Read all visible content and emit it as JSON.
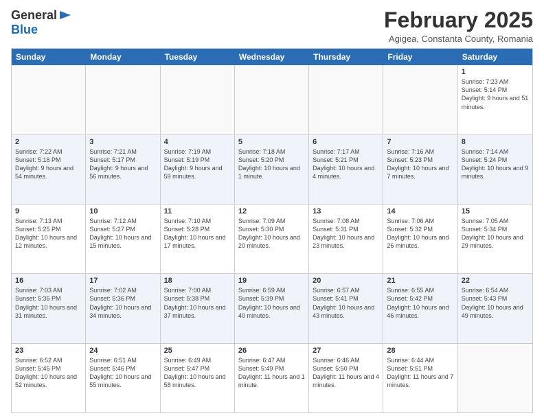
{
  "logo": {
    "general": "General",
    "blue": "Blue"
  },
  "title": "February 2025",
  "location": "Agigea, Constanta County, Romania",
  "days_of_week": [
    "Sunday",
    "Monday",
    "Tuesday",
    "Wednesday",
    "Thursday",
    "Friday",
    "Saturday"
  ],
  "weeks": [
    [
      {
        "day": "",
        "info": ""
      },
      {
        "day": "",
        "info": ""
      },
      {
        "day": "",
        "info": ""
      },
      {
        "day": "",
        "info": ""
      },
      {
        "day": "",
        "info": ""
      },
      {
        "day": "",
        "info": ""
      },
      {
        "day": "1",
        "info": "Sunrise: 7:23 AM\nSunset: 5:14 PM\nDaylight: 9 hours and 51 minutes."
      }
    ],
    [
      {
        "day": "2",
        "info": "Sunrise: 7:22 AM\nSunset: 5:16 PM\nDaylight: 9 hours and 54 minutes."
      },
      {
        "day": "3",
        "info": "Sunrise: 7:21 AM\nSunset: 5:17 PM\nDaylight: 9 hours and 56 minutes."
      },
      {
        "day": "4",
        "info": "Sunrise: 7:19 AM\nSunset: 5:19 PM\nDaylight: 9 hours and 59 minutes."
      },
      {
        "day": "5",
        "info": "Sunrise: 7:18 AM\nSunset: 5:20 PM\nDaylight: 10 hours and 1 minute."
      },
      {
        "day": "6",
        "info": "Sunrise: 7:17 AM\nSunset: 5:21 PM\nDaylight: 10 hours and 4 minutes."
      },
      {
        "day": "7",
        "info": "Sunrise: 7:16 AM\nSunset: 5:23 PM\nDaylight: 10 hours and 7 minutes."
      },
      {
        "day": "8",
        "info": "Sunrise: 7:14 AM\nSunset: 5:24 PM\nDaylight: 10 hours and 9 minutes."
      }
    ],
    [
      {
        "day": "9",
        "info": "Sunrise: 7:13 AM\nSunset: 5:25 PM\nDaylight: 10 hours and 12 minutes."
      },
      {
        "day": "10",
        "info": "Sunrise: 7:12 AM\nSunset: 5:27 PM\nDaylight: 10 hours and 15 minutes."
      },
      {
        "day": "11",
        "info": "Sunrise: 7:10 AM\nSunset: 5:28 PM\nDaylight: 10 hours and 17 minutes."
      },
      {
        "day": "12",
        "info": "Sunrise: 7:09 AM\nSunset: 5:30 PM\nDaylight: 10 hours and 20 minutes."
      },
      {
        "day": "13",
        "info": "Sunrise: 7:08 AM\nSunset: 5:31 PM\nDaylight: 10 hours and 23 minutes."
      },
      {
        "day": "14",
        "info": "Sunrise: 7:06 AM\nSunset: 5:32 PM\nDaylight: 10 hours and 26 minutes."
      },
      {
        "day": "15",
        "info": "Sunrise: 7:05 AM\nSunset: 5:34 PM\nDaylight: 10 hours and 29 minutes."
      }
    ],
    [
      {
        "day": "16",
        "info": "Sunrise: 7:03 AM\nSunset: 5:35 PM\nDaylight: 10 hours and 31 minutes."
      },
      {
        "day": "17",
        "info": "Sunrise: 7:02 AM\nSunset: 5:36 PM\nDaylight: 10 hours and 34 minutes."
      },
      {
        "day": "18",
        "info": "Sunrise: 7:00 AM\nSunset: 5:38 PM\nDaylight: 10 hours and 37 minutes."
      },
      {
        "day": "19",
        "info": "Sunrise: 6:59 AM\nSunset: 5:39 PM\nDaylight: 10 hours and 40 minutes."
      },
      {
        "day": "20",
        "info": "Sunrise: 6:57 AM\nSunset: 5:41 PM\nDaylight: 10 hours and 43 minutes."
      },
      {
        "day": "21",
        "info": "Sunrise: 6:55 AM\nSunset: 5:42 PM\nDaylight: 10 hours and 46 minutes."
      },
      {
        "day": "22",
        "info": "Sunrise: 6:54 AM\nSunset: 5:43 PM\nDaylight: 10 hours and 49 minutes."
      }
    ],
    [
      {
        "day": "23",
        "info": "Sunrise: 6:52 AM\nSunset: 5:45 PM\nDaylight: 10 hours and 52 minutes."
      },
      {
        "day": "24",
        "info": "Sunrise: 6:51 AM\nSunset: 5:46 PM\nDaylight: 10 hours and 55 minutes."
      },
      {
        "day": "25",
        "info": "Sunrise: 6:49 AM\nSunset: 5:47 PM\nDaylight: 10 hours and 58 minutes."
      },
      {
        "day": "26",
        "info": "Sunrise: 6:47 AM\nSunset: 5:49 PM\nDaylight: 11 hours and 1 minute."
      },
      {
        "day": "27",
        "info": "Sunrise: 6:46 AM\nSunset: 5:50 PM\nDaylight: 11 hours and 4 minutes."
      },
      {
        "day": "28",
        "info": "Sunrise: 6:44 AM\nSunset: 5:51 PM\nDaylight: 11 hours and 7 minutes."
      },
      {
        "day": "",
        "info": ""
      }
    ]
  ]
}
